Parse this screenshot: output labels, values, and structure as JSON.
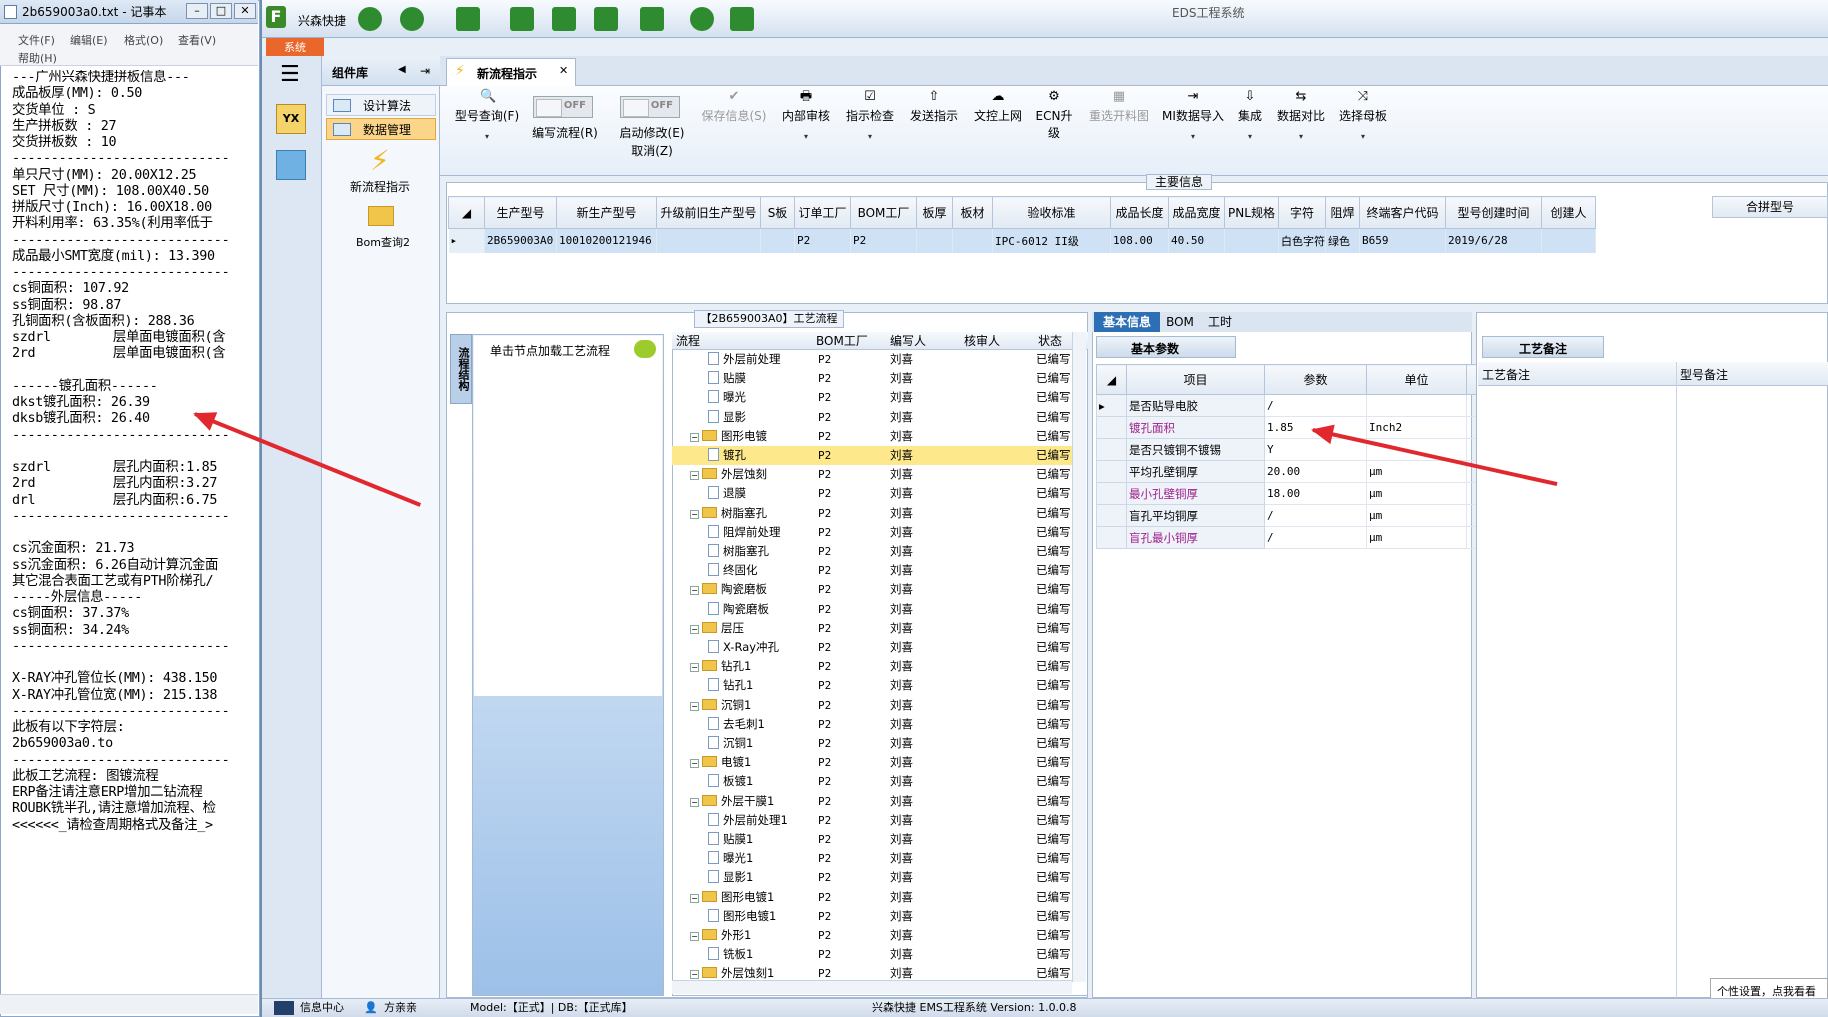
{
  "notepad": {
    "title": "2b659003a0.txt - 记事本",
    "menu": [
      "文件(F)",
      "编辑(E)",
      "格式(O)",
      "查看(V)",
      "帮助(H)"
    ],
    "lines": [
      "---广州兴森快捷拼板信息---",
      "成品板厚(MM): 0.50",
      "交货单位 : S",
      "生产拼板数 : 27",
      "交货拼板数 : 10",
      "----------------------------",
      "单只尺寸(MM): 20.00X12.25",
      "SET 尺寸(MM): 108.00X40.50",
      "拼版尺寸(Inch): 16.00X18.00",
      "开料利用率: 63.35%(利用率低于",
      "----------------------------",
      "成品最小SMT宽度(mil): 13.390",
      "----------------------------",
      "cs铜面积: 107.92",
      "ss铜面积: 98.87",
      "孔铜面积(含板面积): 288.36",
      "szdrl        层单面电镀面积(含",
      "2rd          层单面电镀面积(含",
      "",
      "------镀孔面积------",
      "dkst镀孔面积: 26.39",
      "dksb镀孔面积: 26.40",
      "----------------------------",
      "",
      "szdrl        层孔内面积:1.85",
      "2rd          层孔内面积:3.27",
      "drl          层孔内面积:6.75",
      "----------------------------",
      "",
      "cs沉金面积: 21.73",
      "ss沉金面积: 6.26自动计算沉金面",
      "其它混合表面工艺或有PTH阶梯孔/",
      "-----外层信息-----",
      "cs铜面积: 37.37%",
      "ss铜面积: 34.24%",
      "----------------------------",
      "",
      "X-RAY冲孔管位长(MM): 438.150",
      "X-RAY冲孔管位宽(MM): 215.138",
      "----------------------------",
      "此板有以下字符层:",
      "2b659003a0.to",
      "----------------------------",
      "此板工艺流程: 图镀流程",
      "ERP备注请注意ERP增加二钻流程",
      "ROUBK铣半孔,请注意增加流程、检",
      "<<<<<<_请检查周期格式及备注_>"
    ]
  },
  "app": {
    "title": "EDS工程系统",
    "brand": "兴森快捷",
    "sys_tab": "系统",
    "nav_header": "组件库",
    "nav_items": [
      "设计算法",
      "数据管理"
    ],
    "nav_shortcuts": [
      "新流程指示",
      "Bom查询2"
    ],
    "doc_tab": "新流程指示",
    "ribbon": [
      {
        "label": "型号查询(F)",
        "icon": "🔍"
      },
      {
        "label": "编写流程(R)",
        "toggle": "OFF"
      },
      {
        "label": "启动修改(E)",
        "label2": "取消(Z)",
        "toggle": "OFF"
      },
      {
        "label": "保存信息(S)",
        "icon": "✔",
        "disabled": true
      },
      {
        "label": "内部审核",
        "icon": "🖶"
      },
      {
        "label": "指示检查",
        "icon": "☑"
      },
      {
        "label": "发送指示",
        "icon": "⇧"
      },
      {
        "label": "文控上网",
        "icon": "☁"
      },
      {
        "label": "ECN升级",
        "icon": "⚙"
      },
      {
        "label": "重选开料图",
        "icon": "▦",
        "disabled": true
      },
      {
        "label": "MI数据导入",
        "icon": "⇥"
      },
      {
        "label": "集成",
        "icon": "⇩"
      },
      {
        "label": "数据对比",
        "icon": "⇆"
      },
      {
        "label": "选择母板",
        "icon": "⤨"
      }
    ],
    "main_info_title": "主要信息",
    "main_grid": {
      "columns": [
        "生产型号",
        "新生产型号",
        "升级前旧生产型号",
        "S板",
        "订单工厂",
        "BOM工厂",
        "板厚",
        "板材",
        "验收标准",
        "成品长度",
        "成品宽度",
        "PNL规格",
        "字符",
        "阻焊",
        "终端客户代码",
        "型号创建时间",
        "创建人"
      ],
      "row": [
        "2B659003A0",
        "10010200121946",
        "",
        "",
        "P2",
        "P2",
        "",
        "",
        "IPC-6012 II级",
        "108.00",
        "40.50",
        "",
        "白色字符",
        "绿色",
        "B659",
        "2019/6/28",
        ""
      ]
    },
    "merge_header": "合拼型号",
    "flow_title": "【2B659003A0】工艺流程",
    "flow_vtab": "流程结构",
    "flow_hint": "单击节点加载工艺流程",
    "tree_headers": [
      "流程",
      "BOM工厂",
      "编写人",
      "核审人",
      "状态"
    ],
    "tree_rows": [
      {
        "indent": 2,
        "type": "file",
        "name": "外层前处理",
        "bom": "P2",
        "writer": "刘喜",
        "status": "已编写"
      },
      {
        "indent": 2,
        "type": "file",
        "name": "贴膜",
        "bom": "P2",
        "writer": "刘喜",
        "status": "已编写"
      },
      {
        "indent": 2,
        "type": "file",
        "name": "曝光",
        "bom": "P2",
        "writer": "刘喜",
        "status": "已编写"
      },
      {
        "indent": 2,
        "type": "file",
        "name": "显影",
        "bom": "P2",
        "writer": "刘喜",
        "status": "已编写"
      },
      {
        "indent": 1,
        "type": "folder",
        "name": "图形电镀",
        "bom": "P2",
        "writer": "刘喜",
        "status": "已编写"
      },
      {
        "indent": 2,
        "type": "file",
        "name": "镀孔",
        "bom": "P2",
        "writer": "刘喜",
        "status": "已编写",
        "selected": true
      },
      {
        "indent": 1,
        "type": "folder",
        "name": "外层蚀刻",
        "bom": "P2",
        "writer": "刘喜",
        "status": "已编写"
      },
      {
        "indent": 2,
        "type": "file",
        "name": "退膜",
        "bom": "P2",
        "writer": "刘喜",
        "status": "已编写"
      },
      {
        "indent": 1,
        "type": "folder",
        "name": "树脂塞孔",
        "bom": "P2",
        "writer": "刘喜",
        "status": "已编写"
      },
      {
        "indent": 2,
        "type": "file",
        "name": "阻焊前处理",
        "bom": "P2",
        "writer": "刘喜",
        "status": "已编写"
      },
      {
        "indent": 2,
        "type": "file",
        "name": "树脂塞孔",
        "bom": "P2",
        "writer": "刘喜",
        "status": "已编写"
      },
      {
        "indent": 2,
        "type": "file",
        "name": "终固化",
        "bom": "P2",
        "writer": "刘喜",
        "status": "已编写"
      },
      {
        "indent": 1,
        "type": "folder",
        "name": "陶瓷磨板",
        "bom": "P2",
        "writer": "刘喜",
        "status": "已编写"
      },
      {
        "indent": 2,
        "type": "file",
        "name": "陶瓷磨板",
        "bom": "P2",
        "writer": "刘喜",
        "status": "已编写"
      },
      {
        "indent": 1,
        "type": "folder",
        "name": "层压",
        "bom": "P2",
        "writer": "刘喜",
        "status": "已编写"
      },
      {
        "indent": 2,
        "type": "file",
        "name": "X-Ray冲孔",
        "bom": "P2",
        "writer": "刘喜",
        "status": "已编写"
      },
      {
        "indent": 1,
        "type": "folder",
        "name": "钻孔1",
        "bom": "P2",
        "writer": "刘喜",
        "status": "已编写"
      },
      {
        "indent": 2,
        "type": "file",
        "name": "钻孔1",
        "bom": "P2",
        "writer": "刘喜",
        "status": "已编写"
      },
      {
        "indent": 1,
        "type": "folder",
        "name": "沉铜1",
        "bom": "P2",
        "writer": "刘喜",
        "status": "已编写"
      },
      {
        "indent": 2,
        "type": "file",
        "name": "去毛刺1",
        "bom": "P2",
        "writer": "刘喜",
        "status": "已编写"
      },
      {
        "indent": 2,
        "type": "file",
        "name": "沉铜1",
        "bom": "P2",
        "writer": "刘喜",
        "status": "已编写"
      },
      {
        "indent": 1,
        "type": "folder",
        "name": "电镀1",
        "bom": "P2",
        "writer": "刘喜",
        "status": "已编写"
      },
      {
        "indent": 2,
        "type": "file",
        "name": "板镀1",
        "bom": "P2",
        "writer": "刘喜",
        "status": "已编写"
      },
      {
        "indent": 1,
        "type": "folder",
        "name": "外层干膜1",
        "bom": "P2",
        "writer": "刘喜",
        "status": "已编写"
      },
      {
        "indent": 2,
        "type": "file",
        "name": "外层前处理1",
        "bom": "P2",
        "writer": "刘喜",
        "status": "已编写"
      },
      {
        "indent": 2,
        "type": "file",
        "name": "贴膜1",
        "bom": "P2",
        "writer": "刘喜",
        "status": "已编写"
      },
      {
        "indent": 2,
        "type": "file",
        "name": "曝光1",
        "bom": "P2",
        "writer": "刘喜",
        "status": "已编写"
      },
      {
        "indent": 2,
        "type": "file",
        "name": "显影1",
        "bom": "P2",
        "writer": "刘喜",
        "status": "已编写"
      },
      {
        "indent": 1,
        "type": "folder",
        "name": "图形电镀1",
        "bom": "P2",
        "writer": "刘喜",
        "status": "已编写"
      },
      {
        "indent": 2,
        "type": "file",
        "name": "图形电镀1",
        "bom": "P2",
        "writer": "刘喜",
        "status": "已编写"
      },
      {
        "indent": 1,
        "type": "folder",
        "name": "外形1",
        "bom": "P2",
        "writer": "刘喜",
        "status": "已编写"
      },
      {
        "indent": 2,
        "type": "file",
        "name": "铣板1",
        "bom": "P2",
        "writer": "刘喜",
        "status": "已编写"
      },
      {
        "indent": 1,
        "type": "folder",
        "name": "外层蚀刻1",
        "bom": "P2",
        "writer": "刘喜",
        "status": "已编写"
      }
    ],
    "mid_tabs": [
      "基本信息",
      "BOM",
      "工时"
    ],
    "basic_params_title": "基本参数",
    "param_headers": [
      "项目",
      "参数",
      "单位"
    ],
    "params": [
      {
        "name": "是否贴导电胶",
        "value": "/",
        "unit": "",
        "purple": false
      },
      {
        "name": "镀孔面积",
        "value": "1.85",
        "unit": "Inch2",
        "purple": true
      },
      {
        "name": "是否只镀铜不镀锡",
        "value": "Y",
        "unit": "",
        "purple": false
      },
      {
        "name": "平均孔壁铜厚",
        "value": "20.00",
        "unit": "μm",
        "purple": false
      },
      {
        "name": "最小孔壁铜厚",
        "value": "18.00",
        "unit": "μm",
        "purple": true
      },
      {
        "name": "盲孔平均铜厚",
        "value": "/",
        "unit": "μm",
        "purple": false
      },
      {
        "name": "盲孔最小铜厚",
        "value": "/",
        "unit": "μm",
        "purple": true
      }
    ],
    "process_notes_title": "工艺备注",
    "right_headers": [
      "工艺备注",
      "型号备注"
    ],
    "tooltip": "个性设置，点我看看",
    "status": {
      "info_center": "信息中心",
      "user": "方亲亲",
      "model": "Model:【正式】| DB:【正式库】",
      "version": "兴森快捷 EMS工程系统 Version: 1.0.0.8"
    }
  }
}
